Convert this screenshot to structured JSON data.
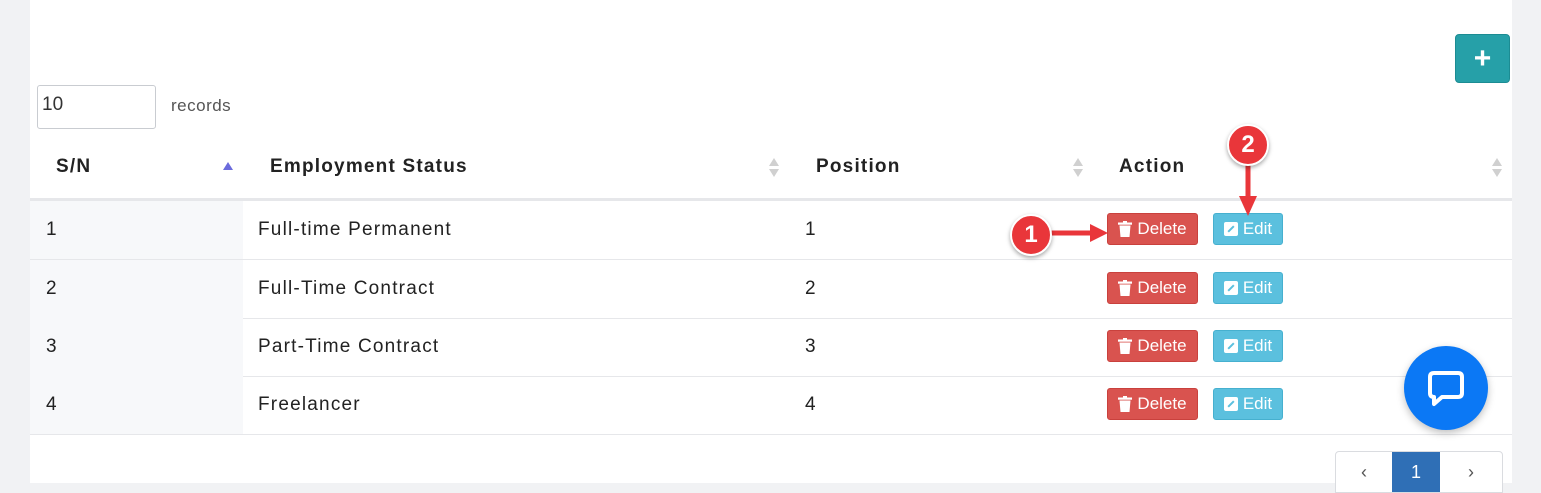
{
  "toolbar": {
    "add_icon": "plus-icon",
    "add_label": "+"
  },
  "records": {
    "value": "10",
    "label": "records"
  },
  "table": {
    "headers": [
      "S/N",
      "Employment Status",
      "Position",
      "Action"
    ],
    "rows": [
      {
        "sn": "1",
        "status": "Full-time Permanent",
        "position": "1"
      },
      {
        "sn": "2",
        "status": "Full-Time Contract",
        "position": "2"
      },
      {
        "sn": "3",
        "status": "Part-Time Contract",
        "position": "3"
      },
      {
        "sn": "4",
        "status": "Freelancer",
        "position": "4"
      }
    ],
    "delete_label": "Delete",
    "edit_label": "Edit"
  },
  "annotations": {
    "badge1": "1",
    "badge2": "2"
  },
  "pagination": {
    "prev": "‹",
    "current": "1",
    "next": "›"
  },
  "colors": {
    "accent": "#26a0a8",
    "delete": "#d9534f",
    "edit": "#5bc0de",
    "chat": "#0b78f5",
    "badge": "#e9363a",
    "page_active": "#2f6fb6"
  }
}
